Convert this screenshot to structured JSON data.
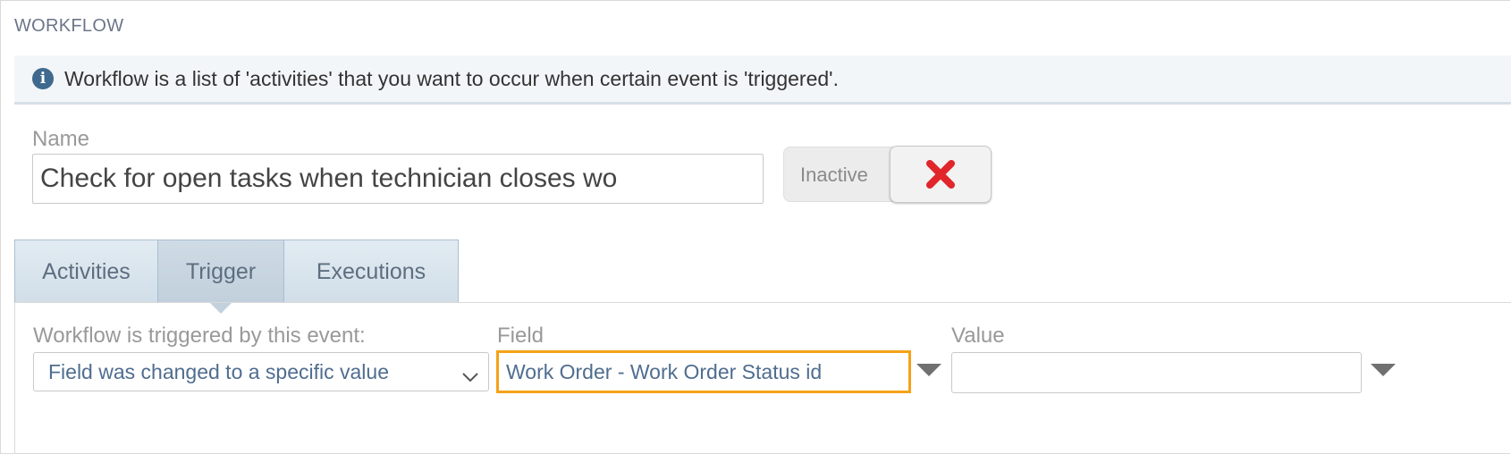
{
  "section_title": "WORKFLOW",
  "info": {
    "icon": "info-icon",
    "text": "Workflow is a list of 'activities' that you want to occur when certain event is 'triggered'."
  },
  "name": {
    "label": "Name",
    "value": "Check for open tasks when technician closes wo"
  },
  "status_toggle": {
    "label": "Inactive",
    "icon": "close-icon",
    "icon_color": "#e0262b"
  },
  "tabs": [
    {
      "label": "Activities",
      "active": false
    },
    {
      "label": "Trigger",
      "active": true
    },
    {
      "label": "Executions",
      "active": false
    }
  ],
  "trigger": {
    "event_label": "Workflow is triggered by this event:",
    "event_value": "Field was changed to a specific value",
    "field_label": "Field",
    "field_value": "Work Order - Work Order Status id",
    "value_label": "Value",
    "value_value": ""
  },
  "colors": {
    "highlight": "#f5a218",
    "info_icon": "#3f6a8e",
    "value_text": "#4f6d8f"
  }
}
